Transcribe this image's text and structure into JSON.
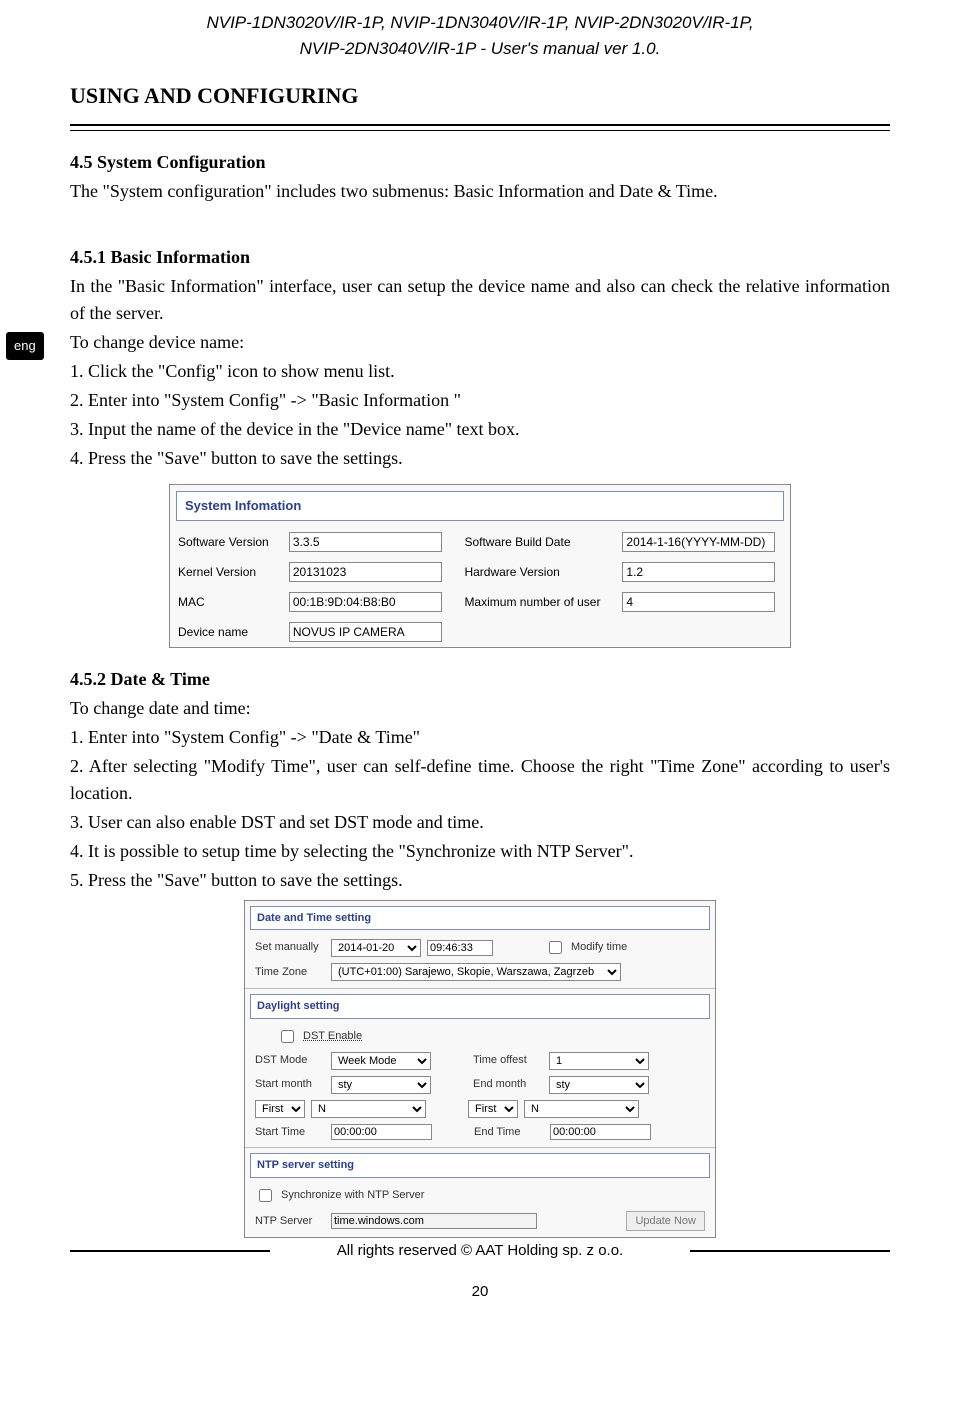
{
  "header": {
    "line1": "NVIP-1DN3020V/IR-1P, NVIP-1DN3040V/IR-1P, NVIP-2DN3020V/IR-1P,",
    "line2": "NVIP-2DN3040V/IR-1P - User's manual ver 1.0."
  },
  "section_title": "USING AND CONFIGURING",
  "lang_tab": "eng",
  "s45": {
    "title": "4.5 System Configuration",
    "desc": "The \"System configuration\" includes two submenus: Basic Information and Date & Time."
  },
  "s451": {
    "title": "4.5.1 Basic Information",
    "intro": "In the \"Basic Information\" interface, user can setup the device name and also can check the relative information of the server.",
    "lead": "To change device name:",
    "steps": [
      "1. Click the \"Config\" icon to show menu list.",
      "2. Enter into \"System Config\" -> \"Basic Information \"",
      "3. Input the name of the device in the \"Device name\" text box.",
      "4. Press the \"Save\" button to save the settings."
    ]
  },
  "panel1": {
    "header": "System Infomation",
    "labels": {
      "sw_ver": "Software Version",
      "sw_build": "Software Build Date",
      "kernel": "Kernel Version",
      "hw_ver": "Hardware Version",
      "mac": "MAC",
      "max_users": "Maximum number  of user",
      "dev_name": "Device name"
    },
    "values": {
      "sw_ver": "3.3.5",
      "sw_build": "2014-1-16(YYYY-MM-DD)",
      "kernel": "20131023",
      "hw_ver": "1.2",
      "mac": "00:1B:9D:04:B8:B0",
      "max_users": "4",
      "dev_name": "NOVUS IP CAMERA"
    }
  },
  "s452": {
    "title": "4.5.2 Date & Time",
    "lead": "To change date and time:",
    "steps": [
      "1. Enter into \"System Config\" -> \"Date & Time\"",
      "2. After selecting \"Modify Time\", user can self-define time. Choose the right \"Time Zone\" according to user's location.",
      "3. User can also enable DST and set DST mode and time.",
      "4. It is possible to setup time by selecting the \"Synchronize with NTP Server\".",
      "5. Press the \"Save\" button to save the settings."
    ]
  },
  "panel2": {
    "header1": "Date and Time setting",
    "set_manually_label": "Set manually",
    "date": "2014-01-20",
    "time": "09:46:33",
    "modify_time_label": "Modify time",
    "tz_label": "Time Zone",
    "tz_value": "(UTC+01:00) Sarajewo, Skopie, Warszawa, Zagrzeb",
    "header2": "Daylight setting",
    "dst_enable": "DST Enable",
    "dst_mode_label": "DST Mode",
    "dst_mode_value": "Week Mode",
    "time_offset_label": "Time offest",
    "time_offset_value": "1",
    "start_month_label": "Start month",
    "start_month_value": "sty",
    "end_month_label": "End month",
    "end_month_value": "sty",
    "week_first": "First",
    "week_n": "N",
    "start_time_label": "Start Time",
    "start_time_value": "00:00:00",
    "end_time_label": "End Time",
    "end_time_value": "00:00:00",
    "header3": "NTP server setting",
    "sync_label": "Synchronize with NTP Server",
    "ntp_label": "NTP Server",
    "ntp_value": "time.windows.com",
    "update_btn": "Update Now"
  },
  "footer": "All rights reserved © AAT Holding sp. z o.o.",
  "page_num": "20"
}
